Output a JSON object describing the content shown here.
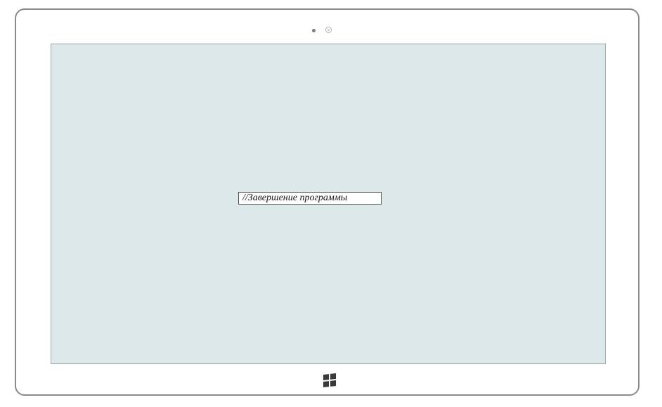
{
  "screen": {
    "background_color": "#dce8e9",
    "comment_text": "//Завершение программы"
  },
  "hardware": {
    "windows_button_icon": "windows-logo-icon"
  }
}
